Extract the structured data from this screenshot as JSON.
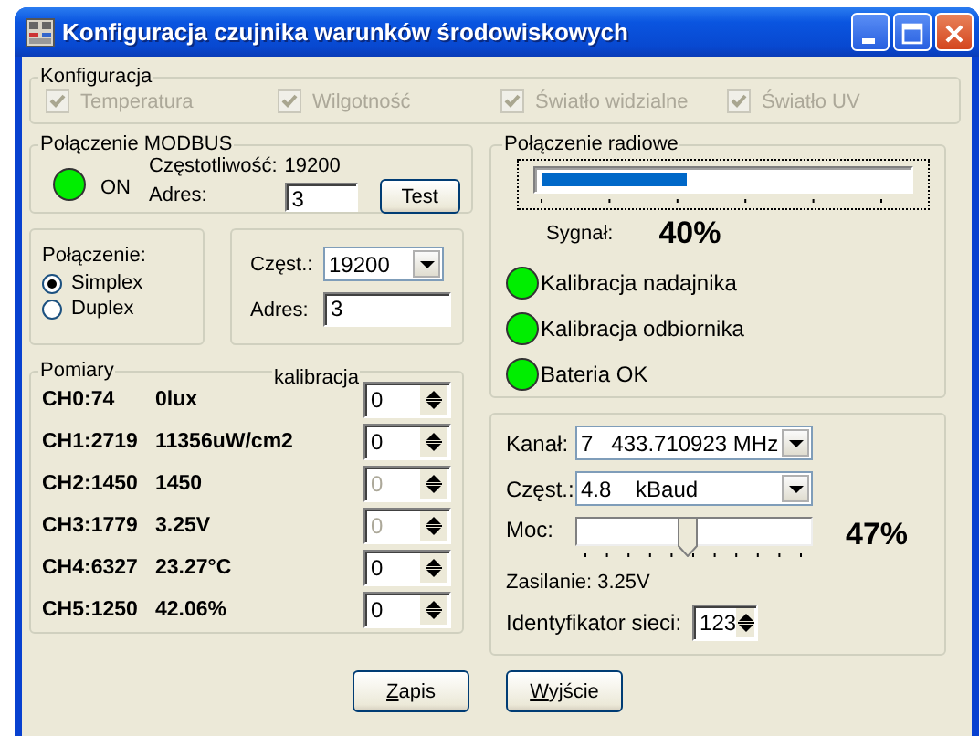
{
  "window": {
    "title": "Konfiguracja czujnika warunków środowiskowych"
  },
  "configuration": {
    "label": "Konfiguracja",
    "checkboxes": [
      {
        "label": "Temperatura",
        "checked": true,
        "disabled": true
      },
      {
        "label": "Wilgotność",
        "checked": true,
        "disabled": true
      },
      {
        "label": "Światło widzialne",
        "checked": true,
        "disabled": true
      },
      {
        "label": "Światło UV",
        "checked": true,
        "disabled": true
      }
    ]
  },
  "modbus": {
    "label": "Połączenie MODBUS",
    "on": true,
    "status": "ON",
    "frequency_label": "Częstotliwość:",
    "frequency": "19200",
    "address_label": "Adres:",
    "address": "3",
    "test_button": "Test"
  },
  "connection": {
    "label": "Połączenie:",
    "options": [
      {
        "label": "Simplex",
        "selected": true
      },
      {
        "label": "Duplex",
        "selected": false
      }
    ]
  },
  "serial": {
    "rate_label": "Częst.:",
    "rate": "19200",
    "address_label": "Adres:",
    "address": "3"
  },
  "measurements": {
    "label": "Pomiary",
    "calibration_label": "kalibracja",
    "channels": [
      {
        "raw": "CH0:74",
        "value": "0lux",
        "calibration": "0",
        "disabled": false
      },
      {
        "raw": "CH1:2719",
        "value": "11356uW/cm2",
        "calibration": "0",
        "disabled": false
      },
      {
        "raw": "CH2:1450",
        "value": "1450",
        "calibration": "0",
        "disabled": true
      },
      {
        "raw": "CH3:1779",
        "value": "3.25V",
        "calibration": "0",
        "disabled": true
      },
      {
        "raw": "CH4:6327",
        "value": "23.27°C",
        "calibration": "0",
        "disabled": false
      },
      {
        "raw": "CH5:1250",
        "value": "42.06%",
        "calibration": "0",
        "disabled": false
      }
    ]
  },
  "radio": {
    "label": "Połączenie radiowe",
    "signal": {
      "level": 0.4
    },
    "signal_label": "Sygnał:",
    "signal_value": "40%",
    "indicators": [
      {
        "label": "Kalibracja nadajnika",
        "on": true
      },
      {
        "label": "Kalibracja odbiornika",
        "on": true
      },
      {
        "label": "Bateria OK",
        "on": true
      }
    ]
  },
  "radio_settings": {
    "channel_label": "Kanał:",
    "channel": "7   433.710923 MHz",
    "rate_label": "Częst.:",
    "rate": "4.8    kBaud",
    "power_label": "Moc:",
    "power": {
      "level": 0.47
    },
    "power_value": "47%",
    "supply": "Zasilanie: 3.25V",
    "network_id_label": "Identyfikator sieci:",
    "network_id": "123"
  },
  "buttons": [
    {
      "label": "Zapis"
    },
    {
      "label": "Wyjście"
    }
  ]
}
